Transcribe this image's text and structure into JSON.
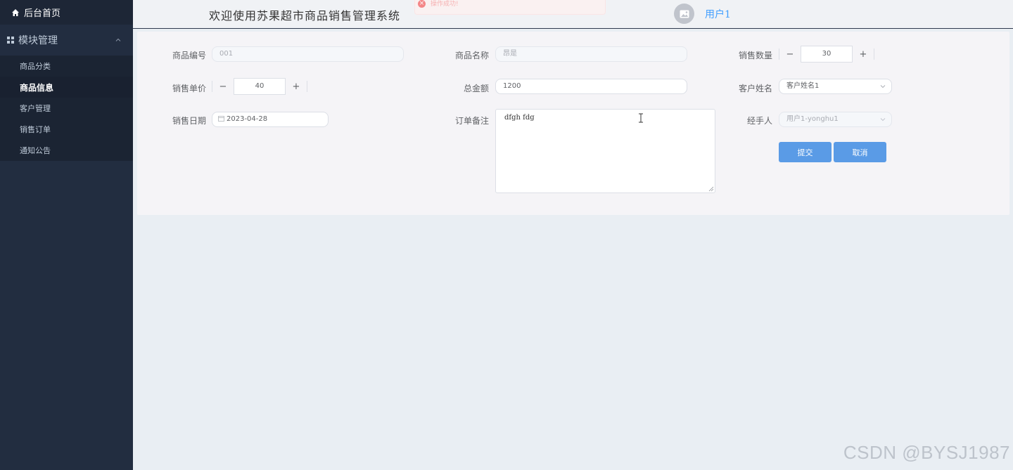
{
  "sidebar": {
    "home_label": "后台首页",
    "group_label": "模块管理",
    "items": [
      {
        "label": "商品分类"
      },
      {
        "label": "商品信息"
      },
      {
        "label": "客户管理"
      },
      {
        "label": "销售订单"
      },
      {
        "label": "通知公告"
      }
    ],
    "active_index": 1
  },
  "header": {
    "title": "欢迎使用苏果超市商品销售管理系统",
    "toast_text": "操作成功!",
    "username": "用户1"
  },
  "form": {
    "product_no": {
      "label": "商品编号",
      "value": "001"
    },
    "product_name": {
      "label": "商品名称",
      "value": "昂是"
    },
    "sale_qty": {
      "label": "销售数量",
      "value": "30",
      "minus": "−",
      "plus": "+"
    },
    "unit_price": {
      "label": "销售单价",
      "value": "40",
      "minus": "−",
      "plus": "+"
    },
    "total": {
      "label": "总金额",
      "value": "1200"
    },
    "customer": {
      "label": "客户姓名",
      "value": "客户姓名1"
    },
    "sale_date": {
      "label": "销售日期",
      "value": "2023-04-28"
    },
    "remark": {
      "label": "订单备注",
      "value": "dfgh fdg"
    },
    "handler": {
      "label": "经手人",
      "value": "用户1-yonghu1"
    },
    "submit_label": "提交",
    "cancel_label": "取消"
  },
  "watermark": "CSDN @BYSJ1987",
  "colors": {
    "sidebar_bg": "#222d40",
    "primary": "#5a9be6",
    "link": "#409eff"
  }
}
